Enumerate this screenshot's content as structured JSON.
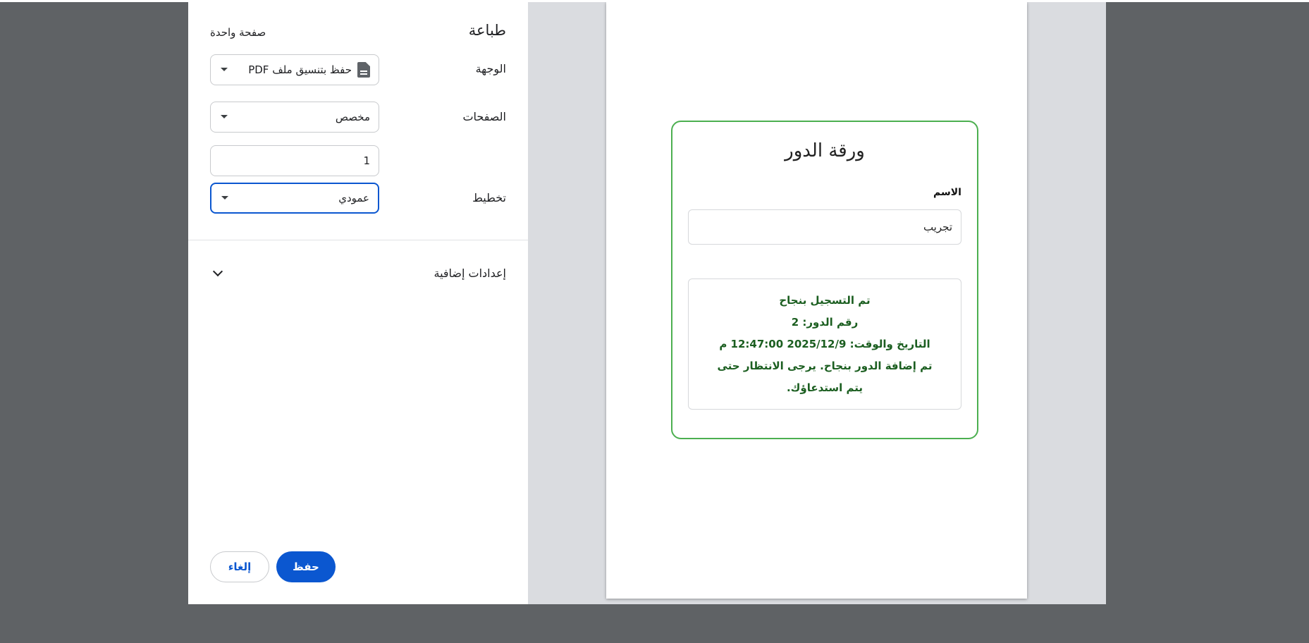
{
  "panel": {
    "title": "طباعة",
    "sheet_count": "صفحة واحدة",
    "destination": {
      "label": "الوجهة",
      "value": "حفظ بتنسيق ملف PDF"
    },
    "pages": {
      "label": "الصفحات",
      "value": "مخصص",
      "custom_value": "1"
    },
    "layout": {
      "label": "تخطيط",
      "value": "عمودي"
    },
    "more_settings": "إعدادات إضافية",
    "save_label": "حفظ",
    "cancel_label": "إلغاء"
  },
  "preview": {
    "title": "ورقة الدور",
    "name_label": "الاسم",
    "name_value": "تجريب",
    "result": {
      "line1": "تم التسجيل بنجاح",
      "line2": "رقم الدور: 2",
      "line3": "التاريخ والوقت: 2025/12/9 12:47:00 م",
      "line4": "تم إضافة الدور بنجاح. يرجى الانتظار حتى يتم استدعاؤك."
    }
  },
  "colors": {
    "accent": "#0b57d0",
    "success_border": "#4caf50",
    "success_text": "#1b5e20"
  }
}
